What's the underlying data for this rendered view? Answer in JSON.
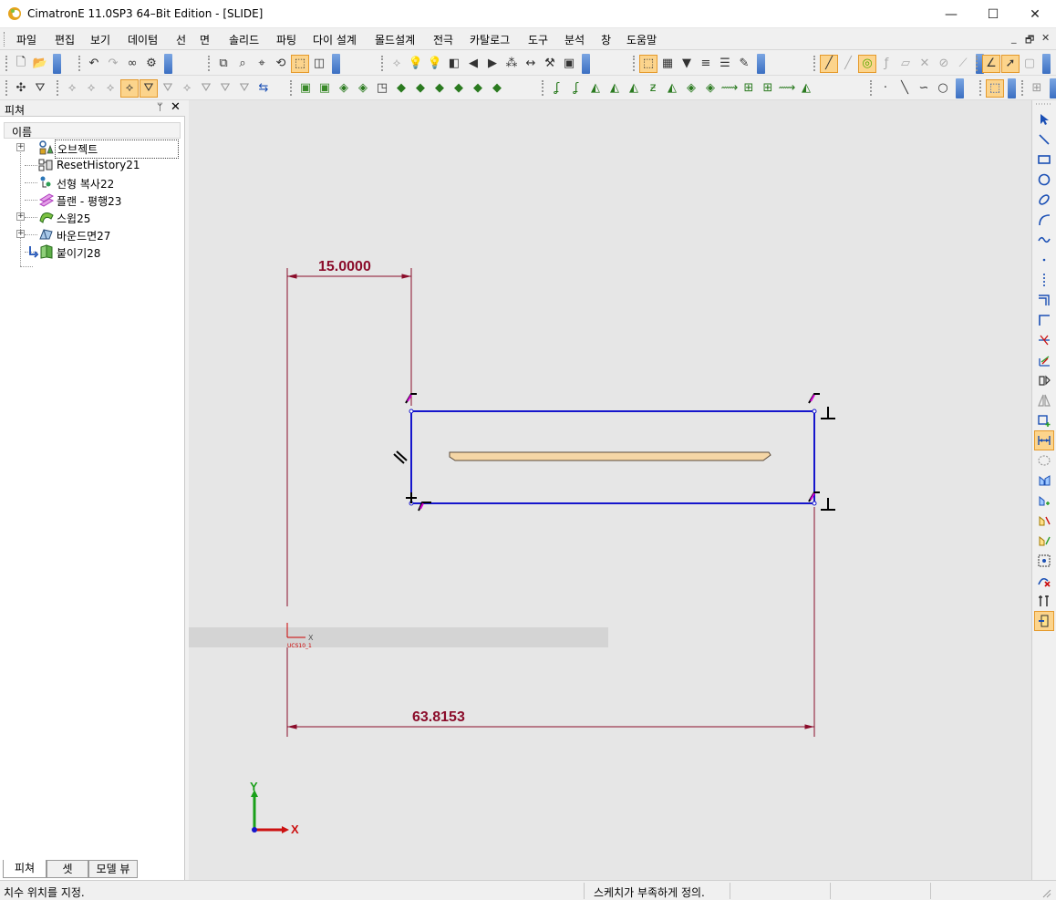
{
  "window": {
    "title": "CimatronE 11.0SP3 64–Bit Edition - [SLIDE]",
    "minimize": "—",
    "maximize": "☐",
    "close": "✕"
  },
  "menu": {
    "items": [
      "파일",
      "편집",
      "보기",
      "데이텀",
      "선",
      "면",
      "솔리드",
      "파팅",
      "다이 설계",
      "몰드설계",
      "전극",
      "카탈로그",
      "도구",
      "분석",
      "창",
      "도움말"
    ],
    "mdi_minimize": "_",
    "mdi_restore": "🗗",
    "mdi_close": "✕"
  },
  "feature_panel": {
    "title": "피쳐",
    "pin": "ᛘ",
    "close": "✕",
    "column_header": "이름",
    "tree": [
      {
        "label": "오브젝트",
        "icon": "object-icon",
        "expandable": true,
        "selected": true
      },
      {
        "label": "ResetHistory21",
        "icon": "reset-history-icon",
        "expandable": false,
        "selected": false
      },
      {
        "label": "선형 복사22",
        "icon": "linear-copy-icon",
        "expandable": false,
        "selected": false
      },
      {
        "label": "플랜 - 평행23",
        "icon": "plane-parallel-icon",
        "expandable": false,
        "selected": false
      },
      {
        "label": "스윕25",
        "icon": "sweep-icon",
        "expandable": true,
        "selected": false
      },
      {
        "label": "바운드면27",
        "icon": "bound-face-icon",
        "expandable": true,
        "selected": false
      },
      {
        "label": "붙이기28",
        "icon": "attach-icon",
        "expandable": false,
        "selected": false
      }
    ],
    "tabs": [
      {
        "label": "피쳐",
        "active": true
      },
      {
        "label": "셋",
        "active": false
      },
      {
        "label": "모델 뷰",
        "active": false
      }
    ]
  },
  "viewport": {
    "dimension_top": "15.0000",
    "dimension_bottom": "63.8153",
    "ucs_label": "UCS10_1",
    "ucs_x_label": "X",
    "axis_x": "X",
    "axis_y": "Y",
    "sketch_color": "#1515cc",
    "dimension_color": "#8b0d2b",
    "constraint_color": "#d000d0"
  },
  "status": {
    "left": "치수 위치를 지정.",
    "middle": "스케치가 부족하게 정의."
  }
}
